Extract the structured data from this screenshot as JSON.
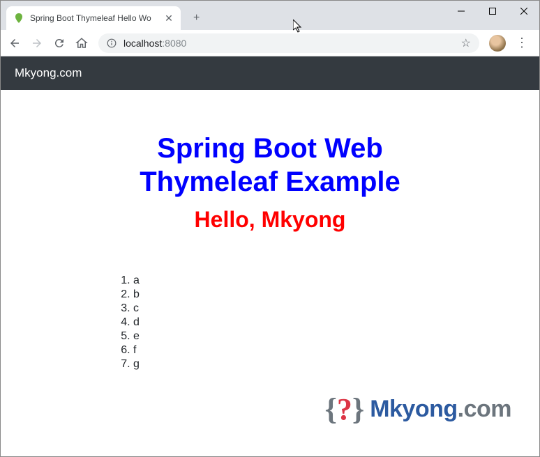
{
  "tab": {
    "title": "Spring Boot Thymeleaf Hello Wo"
  },
  "address": {
    "host": "localhost",
    "port": ":8080"
  },
  "site": {
    "brand": "Mkyong.com"
  },
  "page": {
    "heading_line1": "Spring Boot Web",
    "heading_line2": "Thymeleaf Example",
    "sub_heading": "Hello, Mkyong",
    "items": [
      "a",
      "b",
      "c",
      "d",
      "e",
      "f",
      "g"
    ]
  },
  "footer": {
    "q": "?",
    "name_bold": "Mkyong",
    "name_rest": ".com"
  }
}
